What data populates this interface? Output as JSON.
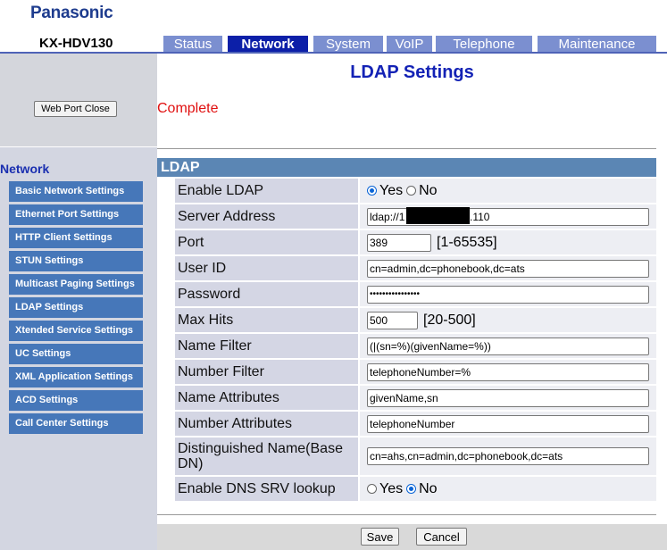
{
  "header": {
    "brand": "Panasonic",
    "model": "KX-HDV130"
  },
  "tabs": [
    {
      "label": "Status",
      "active": false
    },
    {
      "label": "Network",
      "active": true
    },
    {
      "label": "System",
      "active": false
    },
    {
      "label": "VoIP",
      "active": false
    },
    {
      "label": "Telephone",
      "active": false
    },
    {
      "label": "Maintenance",
      "active": false
    }
  ],
  "sidebar": {
    "web_port_close_label": "Web Port Close",
    "section_heading": "Network",
    "items": [
      "Basic Network Settings",
      "Ethernet Port Settings",
      "HTTP Client Settings",
      "STUN Settings",
      "Multicast Paging Settings",
      "LDAP Settings",
      "Xtended Service Settings",
      "UC Settings",
      "XML Application Settings",
      "ACD Settings",
      "Call Center Settings"
    ]
  },
  "main": {
    "title": "LDAP Settings",
    "status": "Complete",
    "section_title": "LDAP"
  },
  "form": {
    "enable_ldap": {
      "label": "Enable LDAP",
      "yes": "Yes",
      "no": "No",
      "selected": "Yes"
    },
    "server_address": {
      "label": "Server Address",
      "value": "ldap://1",
      "value_suffix": ".110"
    },
    "port": {
      "label": "Port",
      "value": "389",
      "range": "[1-65535]"
    },
    "user_id": {
      "label": "User ID",
      "value": "cn=admin,dc=phonebook,dc=ats"
    },
    "password": {
      "label": "Password",
      "value": "••••••••••••••••"
    },
    "max_hits": {
      "label": "Max Hits",
      "value": "500",
      "range": "[20-500]"
    },
    "name_filter": {
      "label": "Name Filter",
      "value": "(|(sn=%)(givenName=%))"
    },
    "number_filter": {
      "label": "Number Filter",
      "value": "telephoneNumber=%"
    },
    "name_attributes": {
      "label": "Name Attributes",
      "value": "givenName,sn"
    },
    "number_attributes": {
      "label": "Number Attributes",
      "value": "telephoneNumber"
    },
    "distinguished_name": {
      "label": "Distinguished Name(Base DN)",
      "value": "cn=ahs,cn=admin,dc=phonebook,dc=ats"
    },
    "dns_srv": {
      "label": "Enable DNS SRV lookup",
      "yes": "Yes",
      "no": "No",
      "selected": "No"
    }
  },
  "footer": {
    "save_label": "Save",
    "cancel_label": "Cancel"
  },
  "colors": {
    "brand": "#1e3c8e",
    "tab_active": "#0c1fa8",
    "tab_inactive": "#7b8fd0",
    "nav_item": "#4677b9",
    "section_bar": "#5b86b4",
    "status": "#e01010"
  }
}
